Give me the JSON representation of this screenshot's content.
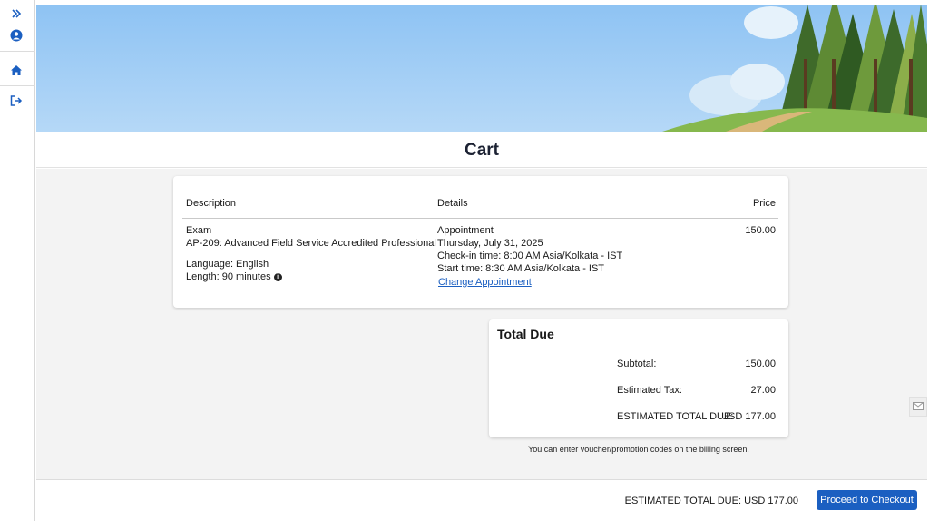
{
  "page": {
    "title": "Cart"
  },
  "sidebar": {
    "icons": [
      "chevrons-right-icon",
      "user-icon",
      "home-icon",
      "logout-icon"
    ]
  },
  "cart": {
    "headers": {
      "description": "Description",
      "details": "Details",
      "price": "Price"
    },
    "item": {
      "type": "Exam",
      "name": "AP-209: Advanced Field Service Accredited Professional",
      "language": "Language: English",
      "length": "Length: 90 minutes",
      "details_title": "Appointment",
      "date": "Thursday, July 31, 2025",
      "checkin": "Check-in time: 8:00 AM Asia/Kolkata - IST",
      "start": "Start time: 8:30 AM Asia/Kolkata - IST",
      "change_link": "Change Appointment",
      "price": "150.00"
    }
  },
  "total_due": {
    "title": "Total Due",
    "subtotal_label": "Subtotal:",
    "subtotal_value": "150.00",
    "tax_label": "Estimated Tax:",
    "tax_value": "27.00",
    "estimated_label": "ESTIMATED TOTAL DUE:",
    "estimated_value": "USD 177.00"
  },
  "voucher_note": "You can enter voucher/promotion codes on the billing screen.",
  "footer": {
    "total_text": "ESTIMATED TOTAL DUE: USD 177.00",
    "checkout_label": "Proceed to Checkout"
  },
  "colors": {
    "accent": "#1b5fc1",
    "sky": "#a3cdf5",
    "hill": "#7fb24a"
  }
}
